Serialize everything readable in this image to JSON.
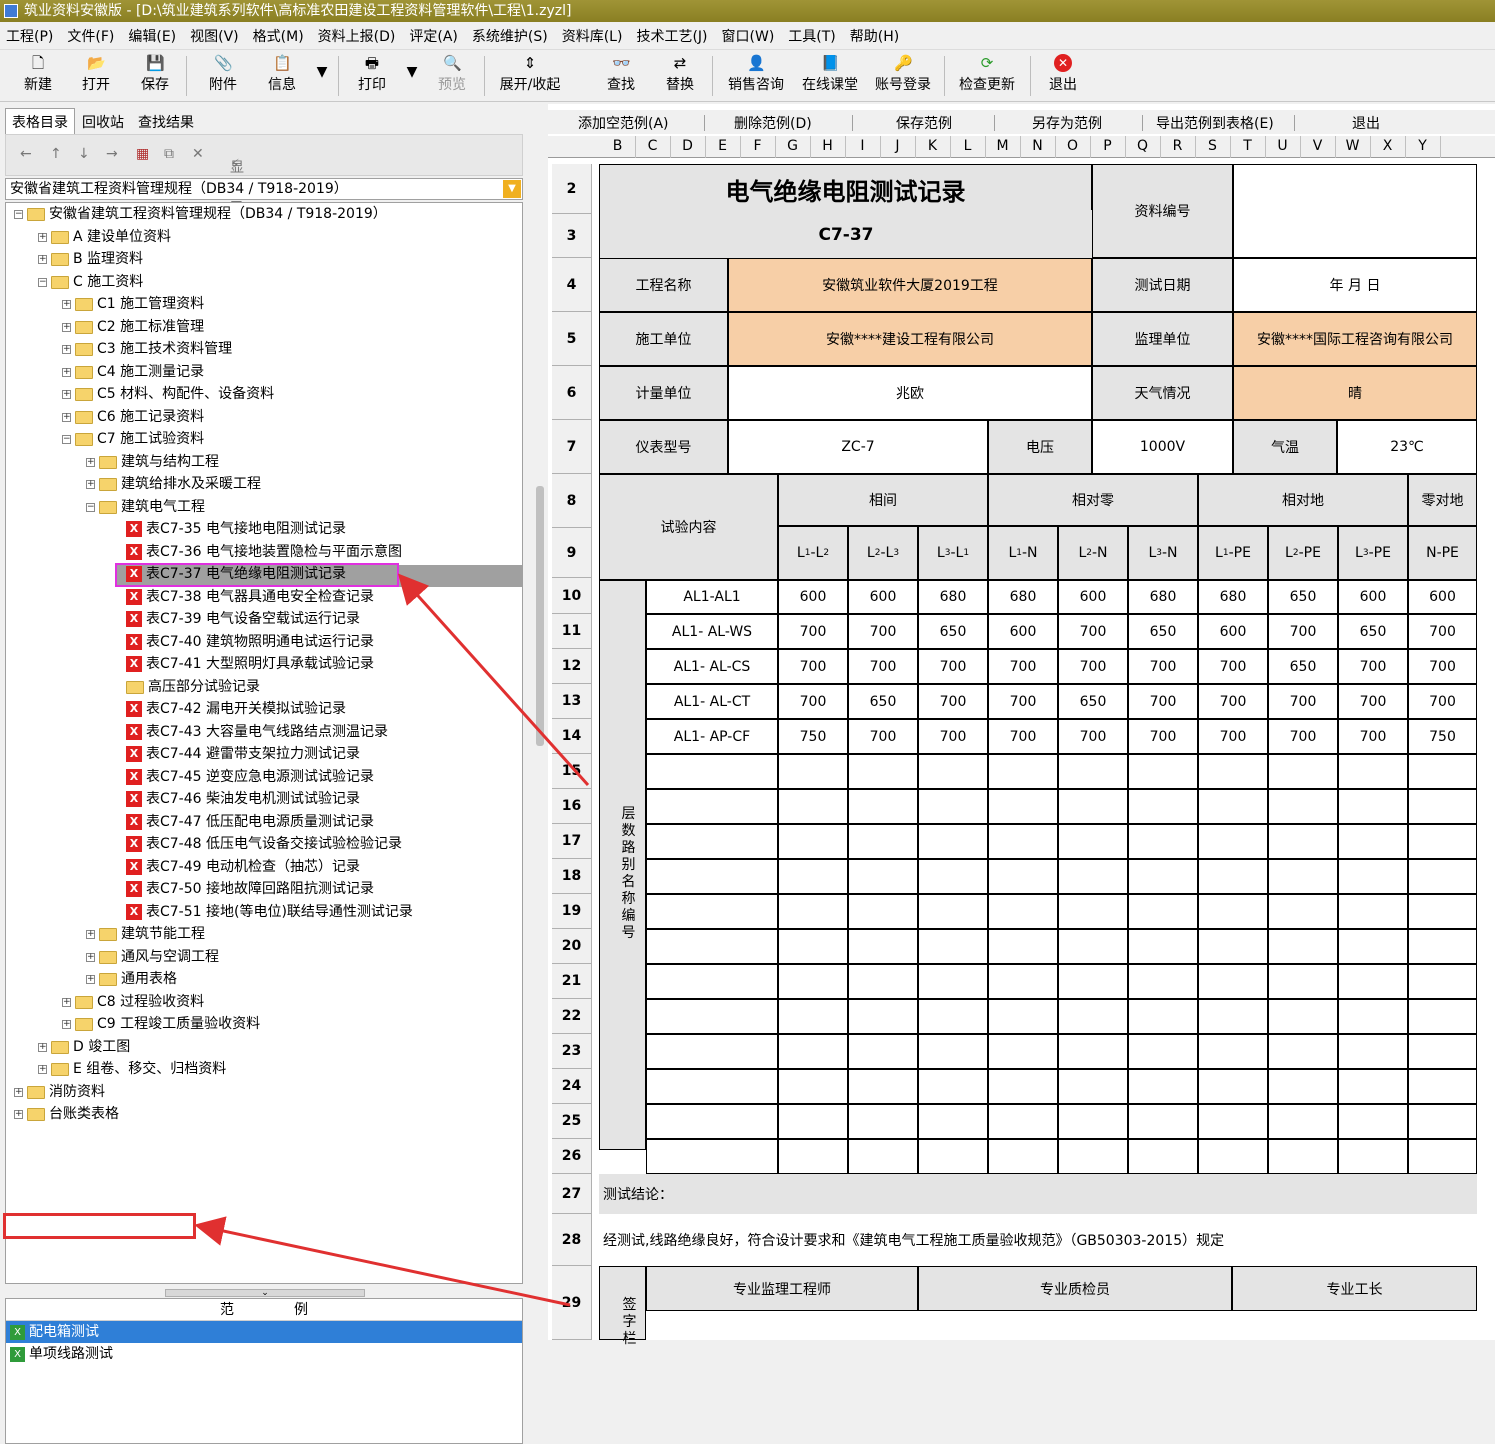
{
  "window": {
    "title": "筑业资料安徽版 - [D:\\筑业建筑系列软件\\高标准农田建设工程资料管理软件\\工程\\1.zyzl]"
  },
  "menu": [
    "工程(P)",
    "文件(F)",
    "编辑(E)",
    "视图(V)",
    "格式(M)",
    "资料上报(D)",
    "评定(A)",
    "系统维护(S)",
    "资料库(L)",
    "技术工艺(J)",
    "窗口(W)",
    "工具(T)",
    "帮助(H)"
  ],
  "toolbar": {
    "new": "新建",
    "open": "打开",
    "save": "保存",
    "attach": "附件",
    "info": "信息",
    "print": "打印",
    "preview": "预览",
    "expand": "展开/收起",
    "find": "查找",
    "replace": "替换",
    "sales": "销售咨询",
    "online": "在线课堂",
    "login": "账号登录",
    "update": "检查更新",
    "exit": "退出"
  },
  "left": {
    "tabs": [
      "表格目录",
      "回收站",
      "查找结果"
    ],
    "show_filled": "显示已填资料",
    "combo": "安徽省建筑工程资料管理规程（DB34 / T918-2019）",
    "tree": [
      "安徽省建筑工程资料管理规程（DB34 / T918-2019）",
      "A 建设单位资料",
      "B 监理资料",
      "C 施工资料",
      "C1 施工管理资料",
      "C2 施工标准管理",
      "C3 施工技术资料管理",
      "C4 施工测量记录",
      "C5 材料、构配件、设备资料",
      "C6 施工记录资料",
      "C7 施工试验资料",
      "建筑与结构工程",
      "建筑给排水及采暖工程",
      "建筑电气工程",
      "表C7-35 电气接地电阻测试记录",
      "表C7-36 电气接地装置隐检与平面示意图",
      "表C7-37 电气绝缘电阻测试记录",
      "表C7-38 电气器具通电安全检查记录",
      "表C7-39 电气设备空载试运行记录",
      "表C7-40 建筑物照明通电试运行记录",
      "表C7-41 大型照明灯具承载试验记录",
      "高压部分试验记录",
      "表C7-42 漏电开关模拟试验记录",
      "表C7-43 大容量电气线路结点测温记录",
      "表C7-44 避雷带支架拉力测试记录",
      "表C7-45 逆变应急电源测试试验记录",
      "表C7-46 柴油发电机测试试验记录",
      "表C7-47 低压配电电源质量测试记录",
      "表C7-48 低压电气设备交接试验检验记录",
      "表C7-49 电动机检查（抽芯）记录",
      "表C7-50 接地故障回路阻抗测试记录",
      "表C7-51 接地(等电位)联结导通性测试记录",
      "建筑节能工程",
      "通风与空调工程",
      "通用表格",
      "C8 过程验收资料",
      "C9 工程竣工质量验收资料",
      "D 竣工图",
      "E 组卷、移交、归档资料",
      "消防资料",
      "台账类表格"
    ],
    "samples": {
      "header1": "范",
      "header2": "例",
      "items": [
        "配电箱测试",
        "单项线路测试"
      ]
    }
  },
  "right": {
    "toolbar": [
      "添加空范例(A)",
      "删除范例(D)",
      "保存范例",
      "另存为范例",
      "导出范例到表格(E)",
      "退出"
    ],
    "columns": [
      "B",
      "C",
      "D",
      "E",
      "F",
      "G",
      "H",
      "I",
      "J",
      "K",
      "L",
      "M",
      "N",
      "O",
      "P",
      "Q",
      "R",
      "S",
      "T",
      "U",
      "V",
      "W",
      "X",
      "Y"
    ],
    "rows": [
      "2",
      "3",
      "4",
      "5",
      "6",
      "7",
      "8",
      "9",
      "10",
      "11",
      "12",
      "13",
      "14",
      "15",
      "16",
      "17",
      "18",
      "19",
      "20",
      "21",
      "22",
      "23",
      "24",
      "25",
      "26",
      "27",
      "28",
      "29"
    ],
    "form": {
      "title": "电气绝缘电阻测试记录",
      "code": "C7-37",
      "doc_no_label": "资料编号",
      "project_label": "工程名称",
      "project": "安徽筑业软件大厦2019工程",
      "test_date_label": "测试日期",
      "test_date": "年    月    日",
      "builder_label": "施工单位",
      "builder": "安徽****建设工程有限公司",
      "supervisor_label": "监理单位",
      "supervisor": "安徽****国际工程咨询有限公司",
      "unit_label": "计量单位",
      "unit": "兆欧",
      "weather_label": "天气情况",
      "weather": "晴",
      "meter_label": "仪表型号",
      "meter": "ZC-7",
      "voltage_label": "电压",
      "voltage": "1000V",
      "temp_label": "气温",
      "temp": "23℃",
      "test_content": "试验内容",
      "groups": [
        "相间",
        "相对零",
        "相对地",
        "零对地"
      ],
      "subcols": [
        "L1-L2",
        "L2-L3",
        "L3-L1",
        "L1-N",
        "L2-N",
        "L3-N",
        "L1-PE",
        "L2-PE",
        "L3-PE",
        "N-PE"
      ],
      "side_label": "层数路别名称编号",
      "data": [
        {
          "name": "AL1-AL1",
          "v": [
            "600",
            "600",
            "680",
            "680",
            "600",
            "680",
            "680",
            "650",
            "600",
            "600"
          ]
        },
        {
          "name": "AL1- AL-WS",
          "v": [
            "700",
            "700",
            "650",
            "600",
            "700",
            "650",
            "600",
            "700",
            "650",
            "700"
          ]
        },
        {
          "name": "AL1- AL-CS",
          "v": [
            "700",
            "700",
            "700",
            "700",
            "700",
            "700",
            "700",
            "650",
            "700",
            "700"
          ]
        },
        {
          "name": "AL1- AL-CT",
          "v": [
            "700",
            "650",
            "700",
            "700",
            "650",
            "700",
            "700",
            "700",
            "700",
            "700"
          ]
        },
        {
          "name": "AL1- AP-CF",
          "v": [
            "750",
            "700",
            "700",
            "700",
            "700",
            "700",
            "700",
            "700",
            "700",
            "750"
          ]
        }
      ],
      "conclusion_label": "测试结论：",
      "conclusion": "经测试,线路绝缘良好，符合设计要求和《建筑电气工程施工质量验收规范》（GB50303-2015）规定",
      "sign_label": "签字栏",
      "sign_cols": [
        "专业监理工程师",
        "专业质检员",
        "专业工长"
      ]
    }
  }
}
